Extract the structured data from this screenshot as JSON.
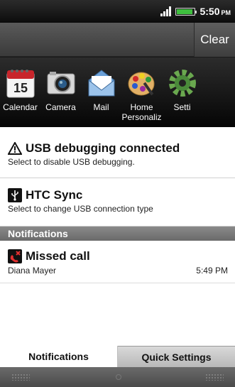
{
  "status_bar": {
    "time": "5:50",
    "ampm": "PM"
  },
  "header": {
    "clear_label": "Clear"
  },
  "apps": [
    {
      "label": "Calendar",
      "icon": "calendar-icon",
      "date_num": "15"
    },
    {
      "label": "Camera",
      "icon": "camera-icon"
    },
    {
      "label": "Mail",
      "icon": "mail-icon"
    },
    {
      "label": "Home",
      "label2": "Personaliz",
      "icon": "palette-icon"
    },
    {
      "label": "Setti",
      "icon": "settings-icon"
    }
  ],
  "notifications": {
    "usb": {
      "title": "USB debugging connected",
      "subtitle": "Select to disable USB debugging."
    },
    "htc": {
      "title": "HTC Sync",
      "subtitle": "Select to change USB connection type"
    },
    "section_title": "Notifications",
    "missed": {
      "title": "Missed call",
      "caller": "Diana Mayer",
      "time": "5:49 PM"
    }
  },
  "tabs": {
    "notifications": "Notifications",
    "quick_settings": "Quick Settings"
  }
}
